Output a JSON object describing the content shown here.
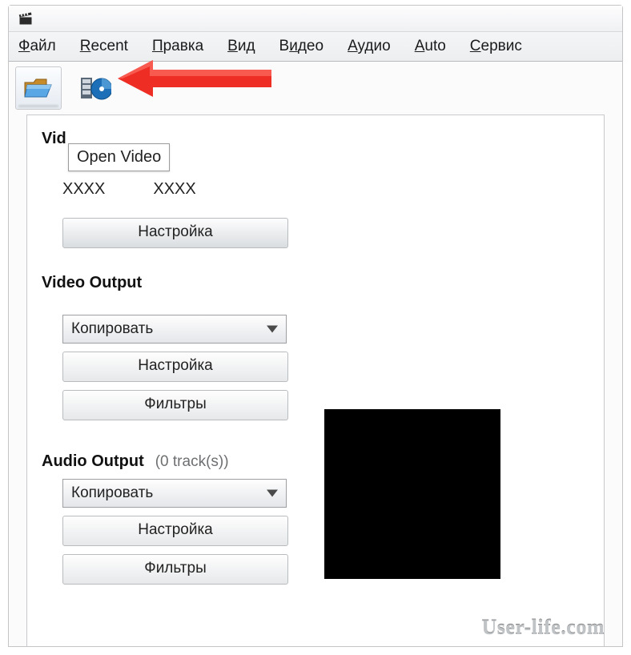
{
  "menubar": {
    "file": "Файл",
    "recent": "Recent",
    "edit": "Правка",
    "view": "Вид",
    "video": "Видео",
    "audio": "Аудио",
    "auto": "Auto",
    "service": "Сервис"
  },
  "tooltip": "Open Video",
  "sections": {
    "video_title": "Vid",
    "xxxx1": "XXXX",
    "xxxx2": "XXXX",
    "settings_btn": "Настройка",
    "video_output_title": "Video Output",
    "copy_option": "Копировать",
    "settings_btn2": "Настройка",
    "filters_btn": "Фильтры",
    "audio_output_title": "Audio Output",
    "audio_tracks": "(0 track(s))",
    "audio_copy_option": "Копировать",
    "audio_settings_btn": "Настройка",
    "audio_filters_btn": "Фильтры"
  },
  "watermark": "User-life.com"
}
